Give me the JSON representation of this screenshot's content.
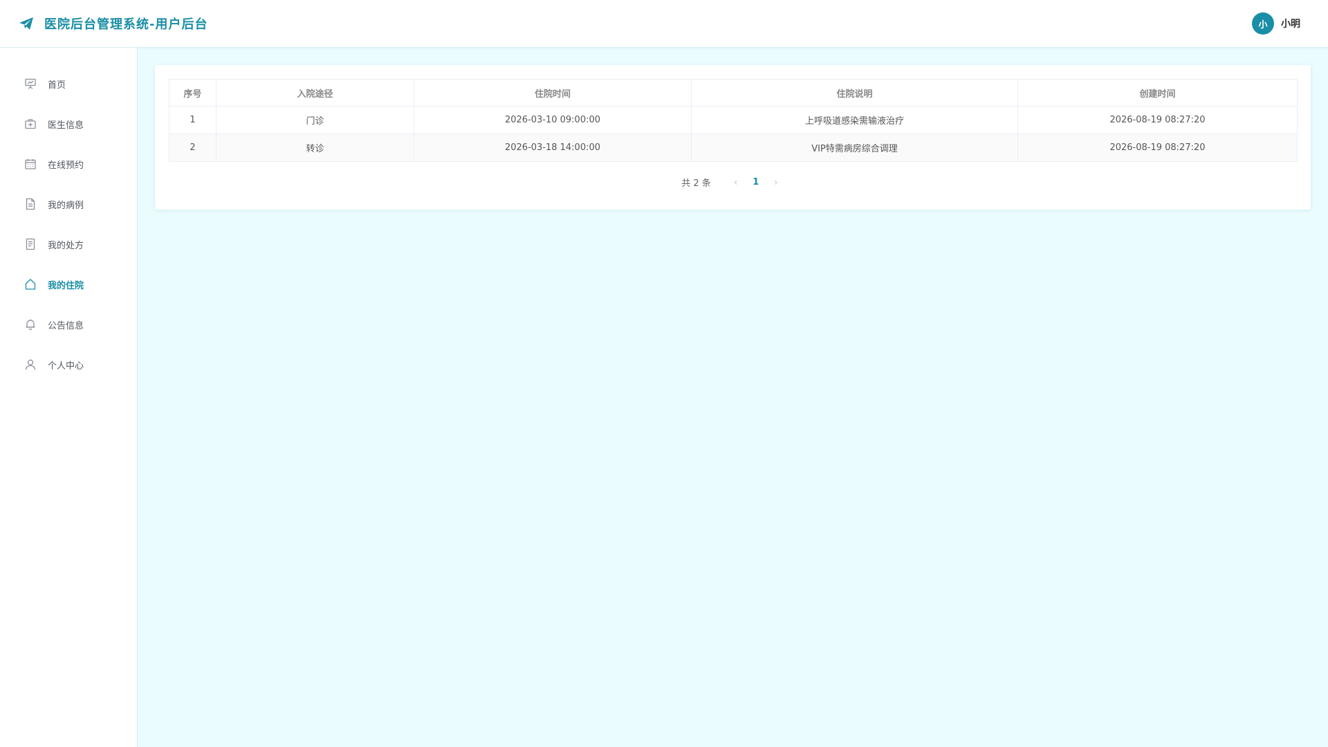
{
  "header": {
    "title": "医院后台管理系统-用户后台",
    "user_avatar_text": "小",
    "username": "小明",
    "accent_color": "#1a8ea6"
  },
  "sidebar": {
    "items": [
      {
        "label": "首页",
        "icon": "presentation-icon"
      },
      {
        "label": "医生信息",
        "icon": "first-aid-kit-icon"
      },
      {
        "label": "在线预约",
        "icon": "calendar-icon"
      },
      {
        "label": "我的病例",
        "icon": "document-icon"
      },
      {
        "label": "我的处方",
        "icon": "list-document-icon"
      },
      {
        "label": "我的住院",
        "icon": "home-icon",
        "active": true
      },
      {
        "label": "公告信息",
        "icon": "bell-icon"
      },
      {
        "label": "个人中心",
        "icon": "user-icon"
      }
    ]
  },
  "table": {
    "columns": [
      "序号",
      "入院途径",
      "住院时间",
      "住院说明",
      "创建时间"
    ],
    "rows": [
      [
        "1",
        "门诊",
        "2026-03-10 09:00:00",
        "上呼吸道感染需输液治疗",
        "2026-08-19 08:27:20"
      ],
      [
        "2",
        "转诊",
        "2026-03-18 14:00:00",
        "VIP特需病房综合调理",
        "2026-08-19 08:27:20"
      ]
    ]
  },
  "pagination": {
    "total_text": "共 2 条",
    "current_page": "1",
    "prev_glyph": "‹",
    "next_glyph": "›"
  }
}
